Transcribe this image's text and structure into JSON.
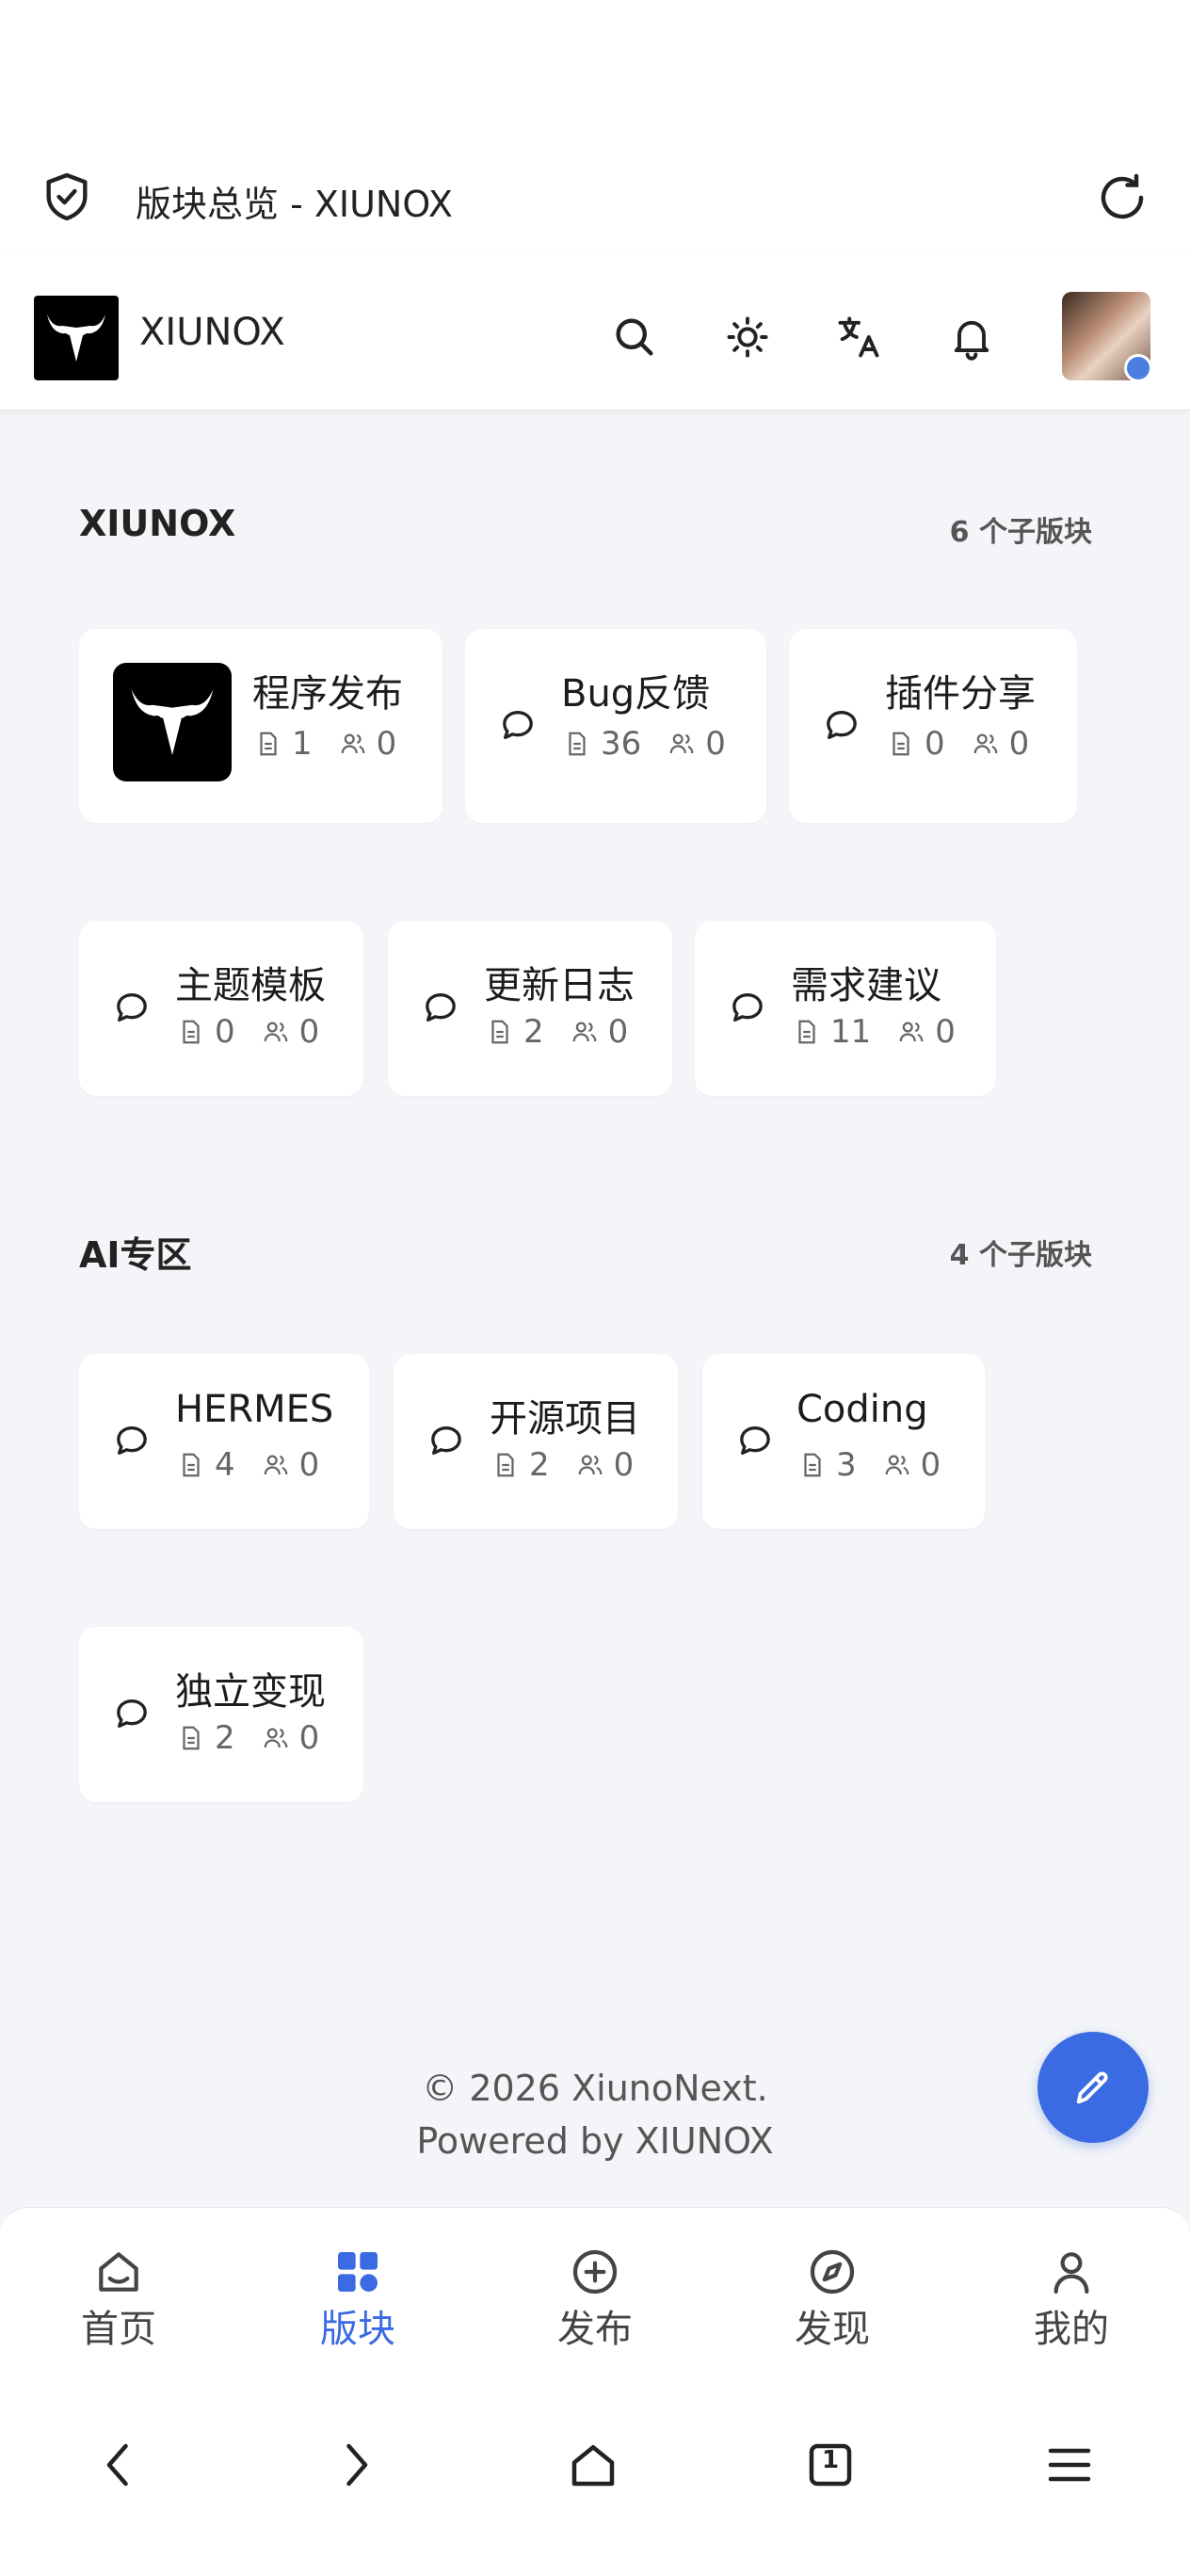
{
  "browser": {
    "tab_title": "版块总览 - XIUNOX"
  },
  "header": {
    "site_name": "XIUNOX"
  },
  "sections": [
    {
      "title": "XIUNOX",
      "count": "6 个子版块",
      "forums": [
        {
          "name": "程序发布",
          "threads": "1",
          "users": "0"
        },
        {
          "name": "Bug反馈",
          "threads": "36",
          "users": "0"
        },
        {
          "name": "插件分享",
          "threads": "0",
          "users": "0"
        },
        {
          "name": "主题模板",
          "threads": "0",
          "users": "0"
        },
        {
          "name": "更新日志",
          "threads": "2",
          "users": "0"
        },
        {
          "name": "需求建议",
          "threads": "11",
          "users": "0"
        }
      ]
    },
    {
      "title": "AI专区",
      "count": "4 个子版块",
      "forums": [
        {
          "name": "HERMES",
          "threads": "4",
          "users": "0"
        },
        {
          "name": "开源项目",
          "threads": "2",
          "users": "0"
        },
        {
          "name": "Coding",
          "threads": "3",
          "users": "0"
        },
        {
          "name": "独立变现",
          "threads": "2",
          "users": "0"
        }
      ]
    }
  ],
  "footer": {
    "copyright": "© 2026 XiunoNext.",
    "powered": "Powered by XIUNOX"
  },
  "bottom_nav": [
    {
      "label": "首页",
      "icon": "home-icon"
    },
    {
      "label": "版块",
      "icon": "grid-icon",
      "active": true
    },
    {
      "label": "发布",
      "icon": "plus-circle-icon"
    },
    {
      "label": "发现",
      "icon": "compass-icon"
    },
    {
      "label": "我的",
      "icon": "user-icon"
    }
  ],
  "system_nav": {
    "tab_count": "1"
  },
  "colors": {
    "accent": "#3a6be3",
    "background": "#f4f5f8",
    "card": "#ffffff"
  }
}
